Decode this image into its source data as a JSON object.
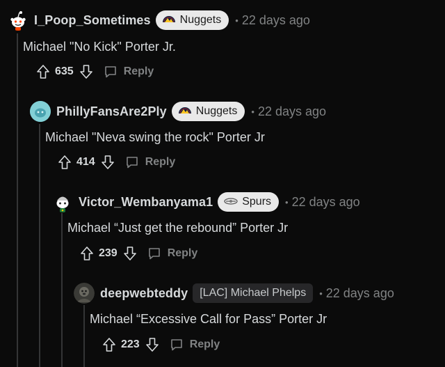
{
  "comments": [
    {
      "username": "I_Poop_Sometimes",
      "flair": "Nuggets",
      "flair_icon": "nuggets-logo-icon",
      "separator": "•",
      "time": "22 days ago",
      "text": "Michael \"No Kick\" Porter Jr.",
      "score": "635",
      "reply_label": "Reply",
      "avatar_icon": "snoo-avatar-icon"
    },
    {
      "username": "PhillyFansAre2Ply",
      "flair": "Nuggets",
      "flair_icon": "nuggets-logo-icon",
      "separator": "•",
      "time": "22 days ago",
      "text": "Michael \"Neva swing the rock\" Porter Jr",
      "score": "414",
      "reply_label": "Reply",
      "avatar_icon": "teal-avatar-icon"
    },
    {
      "username": "Victor_Wembanyama1",
      "flair": "Spurs",
      "flair_icon": "spurs-logo-icon",
      "separator": "•",
      "time": "22 days ago",
      "text": "Michael “Just get the rebound” Porter Jr",
      "score": "239",
      "reply_label": "Reply",
      "avatar_icon": "snoo-avatar-icon"
    },
    {
      "username": "deepwebteddy",
      "flair": "[LAC] Michael Phelps",
      "separator": "•",
      "time": "22 days ago",
      "text": "Michael “Excessive Call for Pass” Porter Jr",
      "score": "223",
      "reply_label": "Reply",
      "avatar_icon": "photo-avatar-icon"
    }
  ],
  "colors": {
    "background": "#0b0b0b",
    "text": "#d7dadc",
    "muted": "#818384",
    "flair_bg": "#e9e9e9",
    "thread_line": "#343536"
  }
}
